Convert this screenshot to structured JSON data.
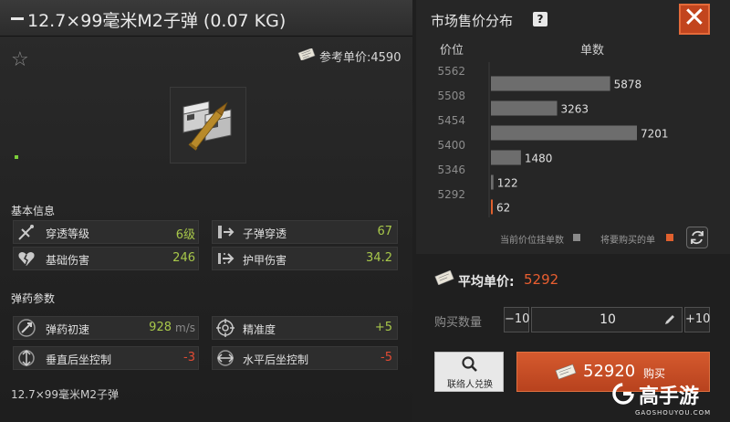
{
  "title": {
    "name": "12.7×99毫米M2子弹 (0.07 KG)"
  },
  "reference": {
    "label": "参考单价:4590"
  },
  "sections": {
    "basic": "基本信息",
    "ammo": "弹药参数"
  },
  "basic_stats": [
    {
      "label": "穿透等级",
      "value": "6级",
      "icon": "penetration-icon",
      "tone": "green"
    },
    {
      "label": "子弹穿透",
      "value": "67",
      "icon": "bullet-pierce-icon",
      "tone": "green"
    },
    {
      "label": "基础伤害",
      "value": "246",
      "icon": "broken-heart-icon",
      "tone": "green"
    },
    {
      "label": "护甲伤害",
      "value": "34.2",
      "icon": "armor-damage-icon",
      "tone": "green"
    }
  ],
  "ammo_stats": [
    {
      "label": "弹药初速",
      "value": "928",
      "unit": "m/s",
      "icon": "velocity-icon",
      "tone": "green"
    },
    {
      "label": "精准度",
      "value": "+5",
      "icon": "crosshair-icon",
      "tone": "green"
    },
    {
      "label": "垂直后坐控制",
      "value": "-3",
      "icon": "vertical-recoil-icon",
      "tone": "red"
    },
    {
      "label": "水平后坐控制",
      "value": "-5",
      "icon": "horizontal-recoil-icon",
      "tone": "red"
    }
  ],
  "footer": {
    "item_name": "12.7×99毫米M2子弹"
  },
  "market": {
    "title": "市场售价分布",
    "help": "?",
    "close": "✕",
    "col_price": "价位",
    "col_count": "单数",
    "legend_current": "当前价位挂单数",
    "legend_buy": "将要购买的单"
  },
  "chart_data": {
    "type": "bar",
    "orientation": "horizontal",
    "categories": [
      "5562",
      "5508",
      "5454",
      "5400",
      "5346",
      "5292"
    ],
    "values": [
      0,
      5878,
      3263,
      7201,
      1480,
      122,
      62
    ],
    "rows": [
      {
        "price": "5562",
        "count": null
      },
      {
        "price": null,
        "count": 5878
      },
      {
        "price": "5508",
        "count": null
      },
      {
        "price": null,
        "count": 3263
      },
      {
        "price": "5454",
        "count": null
      },
      {
        "price": null,
        "count": 7201
      },
      {
        "price": "5400",
        "count": null
      },
      {
        "price": null,
        "count": 1480
      },
      {
        "price": "5346",
        "count": null
      },
      {
        "price": null,
        "count": 122
      },
      {
        "price": "5292",
        "count": null
      },
      {
        "price": null,
        "count": 62
      }
    ],
    "bars": [
      {
        "count": 5878,
        "label": "5878",
        "highlight": false
      },
      {
        "count": 3263,
        "label": "3263",
        "highlight": false
      },
      {
        "count": 7201,
        "label": "7201",
        "highlight": false
      },
      {
        "count": 1480,
        "label": "1480",
        "highlight": false
      },
      {
        "count": 122,
        "label": "122",
        "highlight": false
      },
      {
        "count": 62,
        "label": "62",
        "highlight": true
      }
    ],
    "price_ticks": [
      "5562",
      "5508",
      "5454",
      "5400",
      "5346",
      "5292"
    ],
    "xlabel": "单数",
    "ylabel": "价位",
    "max_count": 7201,
    "colors": {
      "bar": "#6d6d6d",
      "highlight": "#e0602e",
      "current": "#8a8a8a"
    }
  },
  "purchase": {
    "avg_label": "平均单价:",
    "avg_value": "5292",
    "qty_label": "购买数量",
    "minus": "−10",
    "qty_value": "10",
    "plus": "+10",
    "contact_label": "联络人兑换",
    "buy_total": "52920",
    "buy_label": "购买"
  },
  "watermark": {
    "text": "高手游",
    "url": "GAOSHOUYOU.COM"
  },
  "colors": {
    "accent": "#e85e30",
    "green": "#a8c84a",
    "red": "#e24b34"
  }
}
